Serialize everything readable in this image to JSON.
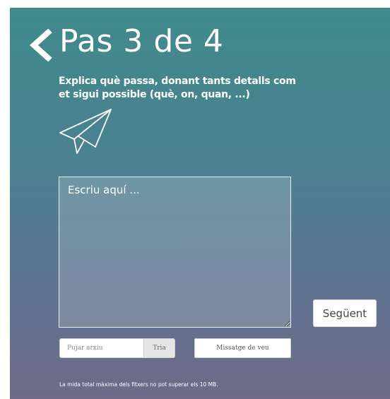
{
  "header": {
    "back_icon": "chevron-left-icon",
    "title": "Pas 3 de 4"
  },
  "instructions": {
    "text": "Explica què passa, donant tants detalls com et sigui possible (què, on, quan, ...)"
  },
  "decoration": {
    "icon": "paper-plane-icon"
  },
  "message": {
    "value": "",
    "placeholder": "Escriu aquí ..."
  },
  "actions": {
    "next_label": "Següent"
  },
  "attachments": {
    "file_placeholder": "Pujar arxiu",
    "choose_label": "Tria",
    "voice_label": "Missatge de veu",
    "size_note": "La mida total màxima dels fitxers no pot superar els 10 MB."
  },
  "colors": {
    "background_top": "#3f8a8b",
    "background_bottom": "#6e6a88",
    "text": "#ffffff"
  }
}
